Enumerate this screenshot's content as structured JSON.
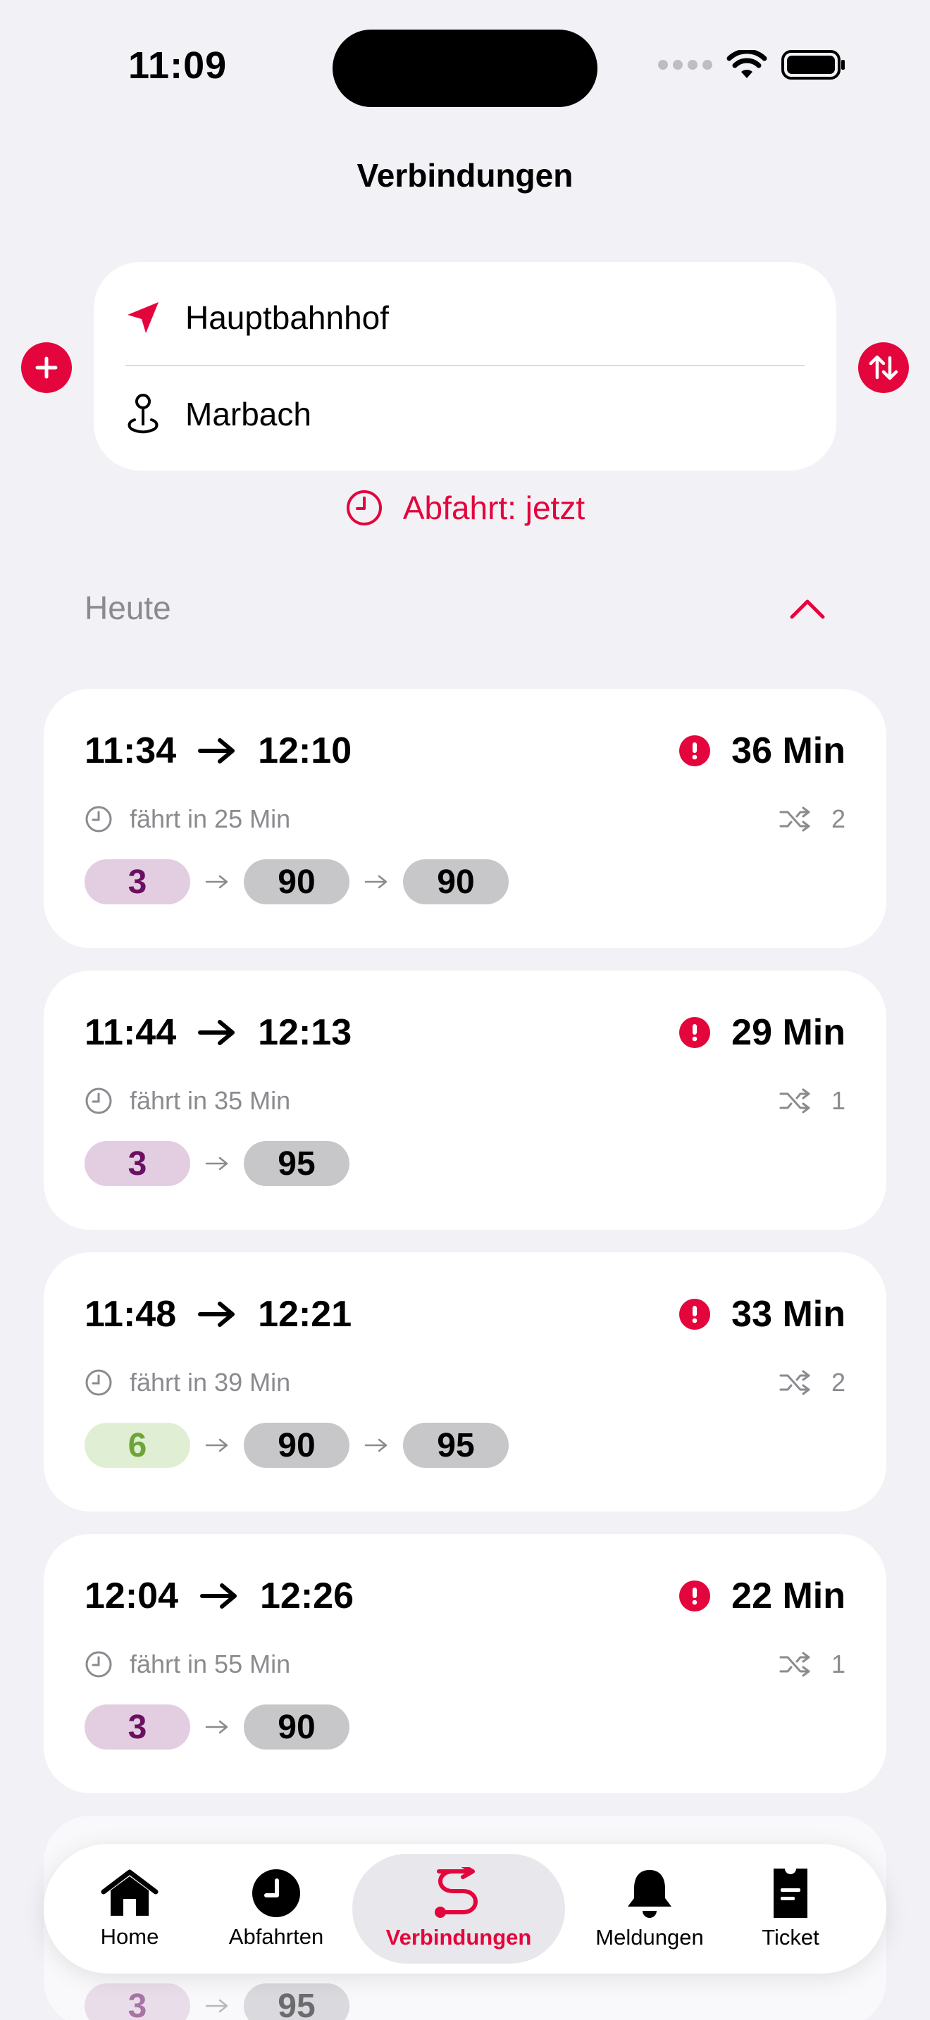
{
  "status_bar": {
    "time": "11:09"
  },
  "header": {
    "title": "Verbindungen"
  },
  "route": {
    "from": "Hauptbahnhof",
    "to": "Marbach"
  },
  "departure": {
    "label": "Abfahrt: jetzt"
  },
  "section": {
    "title": "Heute"
  },
  "connections": [
    {
      "depart": "11:34",
      "arrive": "12:10",
      "duration": "36 Min",
      "info": "fährt in 25 Min",
      "changes": "2",
      "lines": [
        {
          "label": "3",
          "color": "#e2cee0"
        },
        {
          "label": "90",
          "color": "#c7c7c9"
        },
        {
          "label": "90",
          "color": "#c7c7c9"
        }
      ]
    },
    {
      "depart": "11:44",
      "arrive": "12:13",
      "duration": "29 Min",
      "info": "fährt in 35 Min",
      "changes": "1",
      "lines": [
        {
          "label": "3",
          "color": "#e2cee0"
        },
        {
          "label": "95",
          "color": "#c7c7c9"
        }
      ]
    },
    {
      "depart": "11:48",
      "arrive": "12:21",
      "duration": "33 Min",
      "info": "fährt in 39 Min",
      "changes": "2",
      "lines": [
        {
          "label": "6",
          "color": "#e0efd3"
        },
        {
          "label": "90",
          "color": "#c7c7c9"
        },
        {
          "label": "95",
          "color": "#c7c7c9"
        }
      ]
    },
    {
      "depart": "12:04",
      "arrive": "12:26",
      "duration": "22 Min",
      "info": "fährt in 55 Min",
      "changes": "1",
      "lines": [
        {
          "label": "3",
          "color": "#e2cee0"
        },
        {
          "label": "90",
          "color": "#c7c7c9"
        }
      ]
    },
    {
      "lines": [
        {
          "label": "3",
          "color": "#e2cee0"
        },
        {
          "label": "95",
          "color": "#c7c7c9"
        }
      ]
    }
  ],
  "tabbar": {
    "items": [
      {
        "label": "Home",
        "icon": "house-icon"
      },
      {
        "label": "Abfahrten",
        "icon": "clock-icon"
      },
      {
        "label": "Verbindungen",
        "icon": "route-icon"
      },
      {
        "label": "Meldungen",
        "icon": "bell-icon"
      },
      {
        "label": "Ticket",
        "icon": "ticket-icon"
      }
    ]
  },
  "colors": {
    "accent": "#e3053c",
    "background": "#f2f1f6"
  }
}
